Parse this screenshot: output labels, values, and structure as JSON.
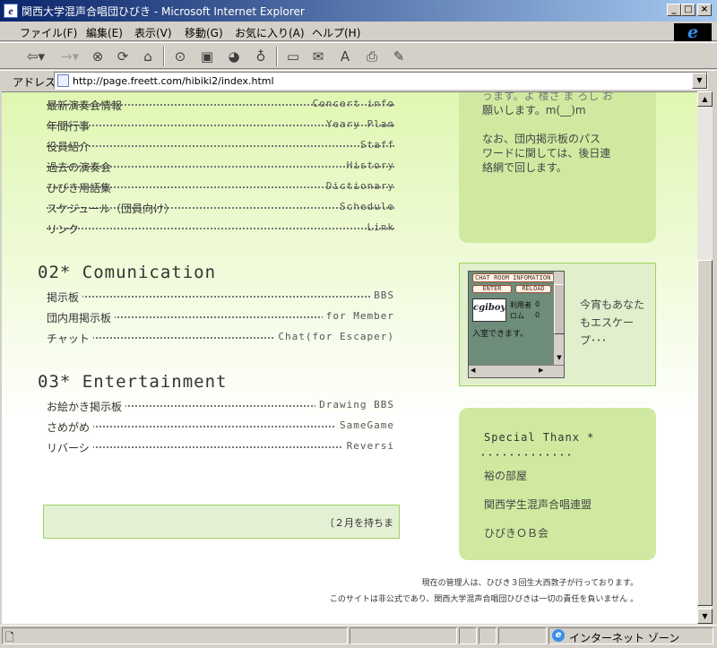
{
  "window": {
    "title": "関西大学混声合唱団ひびき - Microsoft Internet Explorer",
    "minimize": "_",
    "maximize": "□",
    "close": "×"
  },
  "menu": {
    "items": [
      "ファイル(F)",
      "編集(E)",
      "表示(V)",
      "移動(G)",
      "お気に入り(A)",
      "ヘルプ(H)"
    ]
  },
  "address": {
    "label": "アドレス",
    "url": "http://page.freett.com/hibiki2/index.html"
  },
  "content": {
    "section1": {
      "links": [
        {
          "label": "最新演奏会情報",
          "en": "Concert info"
        },
        {
          "label": "年間行事",
          "en": "Yeary Plan"
        },
        {
          "label": "役員紹介",
          "en": "Staff"
        },
        {
          "label": "過去の演奏会",
          "en": "History"
        },
        {
          "label": "ひびき用語集",
          "en": "Dictionary"
        },
        {
          "label": "スケジュール（団員向け）",
          "en": "Schedule"
        },
        {
          "label": "リンク",
          "en": "Link"
        }
      ]
    },
    "section2": {
      "heading": "02* Comunication",
      "links": [
        {
          "label": "掲示板",
          "en": "BBS"
        },
        {
          "label": "団内用掲示板",
          "en": "for Member"
        },
        {
          "label": "チャット",
          "en": "Chat(for Escaper)"
        }
      ]
    },
    "section3": {
      "heading": "03* Entertainment",
      "links": [
        {
          "label": "お絵かき掲示板",
          "en": "Drawing BBS"
        },
        {
          "label": "さめがめ",
          "en": "SameGame"
        },
        {
          "label": "リバーシ",
          "en": "Reversi"
        }
      ]
    },
    "notice_box": {
      "line1": "うます。よ  楼さ  ま  ろし  お",
      "line2": "願いします。m(__)m",
      "line3": "なお、団内掲示板のパス",
      "line4": "ワードに関しては、後日連",
      "line5": "絡網で回します。"
    },
    "chat": {
      "header": "CHAT ROOM INFOMATION",
      "enter": "ENTER",
      "reload": "RELOAD",
      "logo": "cgiboy",
      "users_label": "利用者",
      "users_value": "0",
      "rom_label": "ロム",
      "rom_value": "0",
      "status": "入室できます。",
      "side_text1": "今宵もあなた",
      "side_text2": "もエスケー",
      "side_text3": "プ･･･"
    },
    "thanks": {
      "title": "Special Thanx *",
      "dots": "･････････････",
      "items": [
        "裕の部屋",
        "関西学生混声合唱連盟",
        "ひびきＯＢ会"
      ]
    },
    "marquee": "〔２月を持ちま",
    "footer": {
      "line1": "現在の管理人は、ひびき３回生大西敦子が行っております。",
      "line2": "このサイトは非公式であり、関西大学混声合唱団ひびきは一切の責任を負いません 。"
    }
  },
  "status": {
    "zone": "インターネット ゾーン"
  }
}
